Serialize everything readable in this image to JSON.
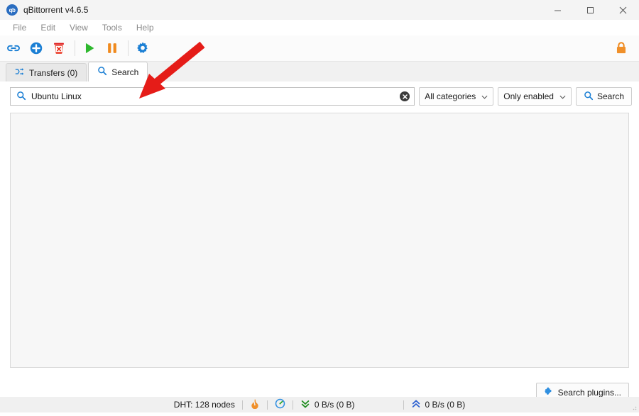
{
  "window": {
    "title": "qBittorrent v4.6.5",
    "logo_text": "qb",
    "controls": [
      {
        "name": "minimize",
        "label": "—"
      },
      {
        "name": "maximize",
        "label": "□"
      },
      {
        "name": "close",
        "label": "✕"
      }
    ]
  },
  "menubar": {
    "items": [
      {
        "label": "File"
      },
      {
        "label": "Edit"
      },
      {
        "label": "View"
      },
      {
        "label": "Tools"
      },
      {
        "label": "Help"
      }
    ]
  },
  "toolbar": {
    "items": [
      {
        "name": "download-link-icon",
        "tip": "Add torrent link"
      },
      {
        "name": "add-torrent-icon",
        "tip": "Add torrent file"
      },
      {
        "name": "delete-icon",
        "tip": "Delete"
      },
      {
        "name": "resume-icon",
        "tip": "Resume"
      },
      {
        "name": "pause-icon",
        "tip": "Pause"
      },
      {
        "name": "preferences-gear-icon",
        "tip": "Options"
      }
    ],
    "lock": {
      "name": "lock-icon",
      "tip": "Lock qBittorrent"
    }
  },
  "tabs": [
    {
      "label": "Transfers (0)",
      "icon": "transfers-icon",
      "active": false
    },
    {
      "label": "Search",
      "icon": "search-icon",
      "active": true
    }
  ],
  "search": {
    "query": "Ubuntu Linux",
    "placeholder": "Search",
    "clear_label": "✕",
    "category": "All categories",
    "plugins_filter": "Only enabled",
    "search_button": "Search",
    "plugins_button": "Search plugins...",
    "results": []
  },
  "statusbar": {
    "dht": "DHT: 128 nodes",
    "flame_icon": "connection-status-icon",
    "speed_icon": "speed-limit-icon",
    "download": "0 B/s (0 B)",
    "upload": "0 B/s (0 B)"
  },
  "colors": {
    "accent_blue": "#1b7fd4",
    "red": "#e02020",
    "green": "#28a428",
    "orange": "#f08a1e",
    "upload_blue": "#2a5fd0",
    "download_green": "#1e8c1e"
  },
  "annotation": {
    "arrow": "red-arrow-pointing-to-search-input",
    "color": "#e51c18"
  }
}
